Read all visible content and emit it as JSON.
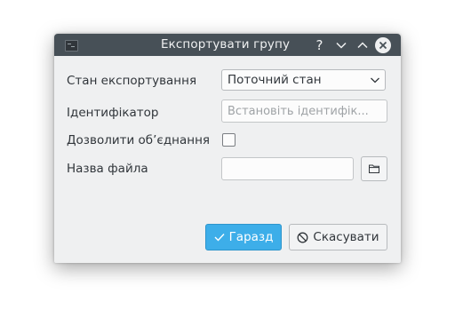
{
  "window": {
    "title": "Експортувати групу",
    "help_glyph": "?",
    "icons": {
      "app": "app-window-icon",
      "help": "help-icon",
      "minimize": "chevron-down-icon",
      "maximize": "chevron-up-icon",
      "close": "close-icon"
    }
  },
  "form": {
    "export_state": {
      "label": "Стан експортування",
      "selected": "Поточний стан"
    },
    "identifier": {
      "label": "Ідентифікатор",
      "value": "",
      "placeholder": "Встановіть ідентифік..."
    },
    "allow_merge": {
      "label": "Дозволити об’єднання",
      "checked": false
    },
    "file_name": {
      "label": "Назва файла",
      "value": "",
      "browse_icon": "folder-icon"
    }
  },
  "buttons": {
    "ok": {
      "label": "Гаразд",
      "icon": "checkmark-icon"
    },
    "cancel": {
      "label": "Скасувати",
      "icon": "cancel-icon"
    }
  },
  "colors": {
    "titlebar": "#475057",
    "dialog_bg": "#eff0f1",
    "accent": "#3daee9",
    "text": "#31363b"
  }
}
